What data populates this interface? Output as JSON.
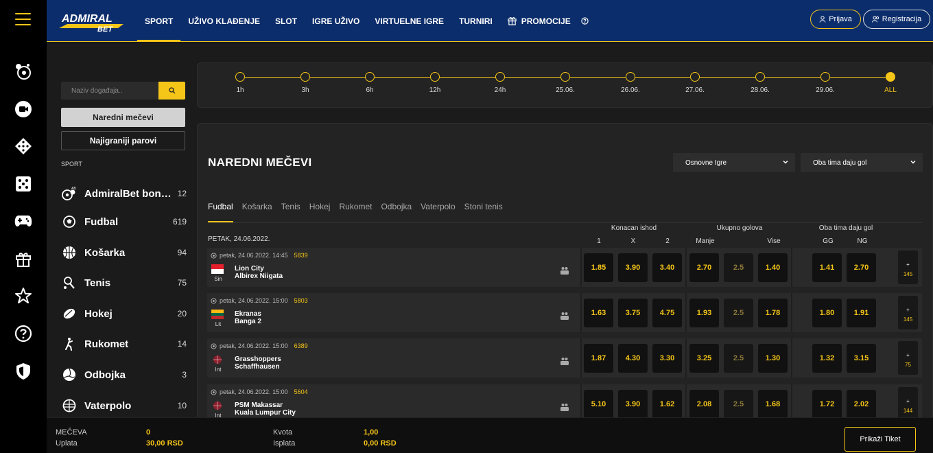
{
  "brand": {
    "logo_top": "ADMIRAL",
    "logo_bottom": "BET",
    "accent": "#f5c518",
    "nav_bg": "#0c2d6b"
  },
  "rail": {
    "icons": [
      "menu-icon",
      "soccer-balls-icon",
      "live-tv-icon",
      "diamond-dice-icon",
      "dice-icon",
      "gamepad-icon",
      "gift-icon",
      "star-icon",
      "help-icon",
      "shield-icon"
    ]
  },
  "nav": {
    "items": [
      "SPORT",
      "UŽIVO KLAĐENJE",
      "SLOT",
      "IGRE UŽIVO",
      "VIRTUELNE IGRE",
      "TURNIRI",
      "PROMOCIJE"
    ],
    "login": "Prijava",
    "register": "Registracija"
  },
  "sidebar": {
    "search_placeholder": "Naziv događaja..",
    "upcoming_button": "Naredni mečevi",
    "top_button": "Najigraniji parovi",
    "section_label": "SPORT",
    "sports": [
      {
        "name": "AdmiralBet bonu...",
        "count": "12",
        "icon": "admiral-bonus-icon"
      },
      {
        "name": "Fudbal",
        "count": "619",
        "icon": "soccer-ball-icon"
      },
      {
        "name": "Košarka",
        "count": "94",
        "icon": "basketball-icon"
      },
      {
        "name": "Tenis",
        "count": "75",
        "icon": "tennis-player-icon"
      },
      {
        "name": "Hokej",
        "count": "20",
        "icon": "hockey-puck-icon"
      },
      {
        "name": "Rukomet",
        "count": "14",
        "icon": "handball-player-icon"
      },
      {
        "name": "Odbojka",
        "count": "3",
        "icon": "volleyball-icon"
      },
      {
        "name": "Vaterpolo",
        "count": "10",
        "icon": "waterpolo-ball-icon"
      }
    ]
  },
  "timeline": {
    "points": [
      "1h",
      "3h",
      "6h",
      "12h",
      "24h",
      "25.06.",
      "26.06.",
      "27.06.",
      "28.06.",
      "29.06.",
      "ALL"
    ],
    "selected": "ALL"
  },
  "main": {
    "title": "NAREDNI MEČEVI",
    "dropdown1": "Osnovne Igre",
    "dropdown2": "Oba tima daju gol",
    "tabs": [
      "Fudbal",
      "Košarka",
      "Tenis",
      "Hokej",
      "Rukomet",
      "Odbojka",
      "Vaterpolo",
      "Stoni tenis"
    ],
    "active_tab": "Fudbal",
    "market_groups": [
      "Konacan ishod",
      "Ukupno golova",
      "Oba tima daju gol"
    ],
    "market_cols": {
      "c1": "1",
      "cx": "X",
      "c2": "2",
      "under": "Manje",
      "over": "Vise",
      "gg": "GG",
      "ng": "NG"
    },
    "date_label": "PETAK, 24.06.2022.",
    "matches": [
      {
        "time": "petak, 24.06.2022. 14:45",
        "code": "5839",
        "country": "Sin",
        "home": "Lion City",
        "away": "Albirex Niigata",
        "o1": "1.85",
        "ox": "3.90",
        "o2": "3.40",
        "under": "2.70",
        "line": "2.5",
        "over": "1.40",
        "gg": "1.41",
        "ng": "2.70",
        "more": "145"
      },
      {
        "time": "petak, 24.06.2022. 15:00",
        "code": "5803",
        "country": "Lit",
        "home": "Ekranas",
        "away": "Banga 2",
        "o1": "1.63",
        "ox": "3.75",
        "o2": "4.75",
        "under": "1.93",
        "line": "2.5",
        "over": "1.78",
        "gg": "1.80",
        "ng": "1.91",
        "more": "145"
      },
      {
        "time": "petak, 24.06.2022. 15:00",
        "code": "6389",
        "country": "Int",
        "home": "Grasshoppers",
        "away": "Schaffhausen",
        "o1": "1.87",
        "ox": "4.30",
        "o2": "3.30",
        "under": "3.25",
        "line": "2.5",
        "over": "1.30",
        "gg": "1.32",
        "ng": "3.15",
        "more": "75"
      },
      {
        "time": "petak, 24.06.2022. 15:00",
        "code": "5604",
        "country": "Int",
        "home": "PSM Makassar",
        "away": "Kuala Lumpur City",
        "o1": "5.10",
        "ox": "3.90",
        "o2": "1.62",
        "under": "2.08",
        "line": "2.5",
        "over": "1.68",
        "gg": "1.72",
        "ng": "2.02",
        "more": "144"
      }
    ]
  },
  "footer": {
    "matches_label": "MEČEVA",
    "matches_value": "0",
    "stake_label": "Uplata",
    "stake_value": "30,00 RSD",
    "odds_label": "Kvota",
    "odds_value": "1,00",
    "payout_label": "Isplata",
    "payout_value": "0,00 RSD",
    "ticket_button": "Prikaži Tiket"
  }
}
